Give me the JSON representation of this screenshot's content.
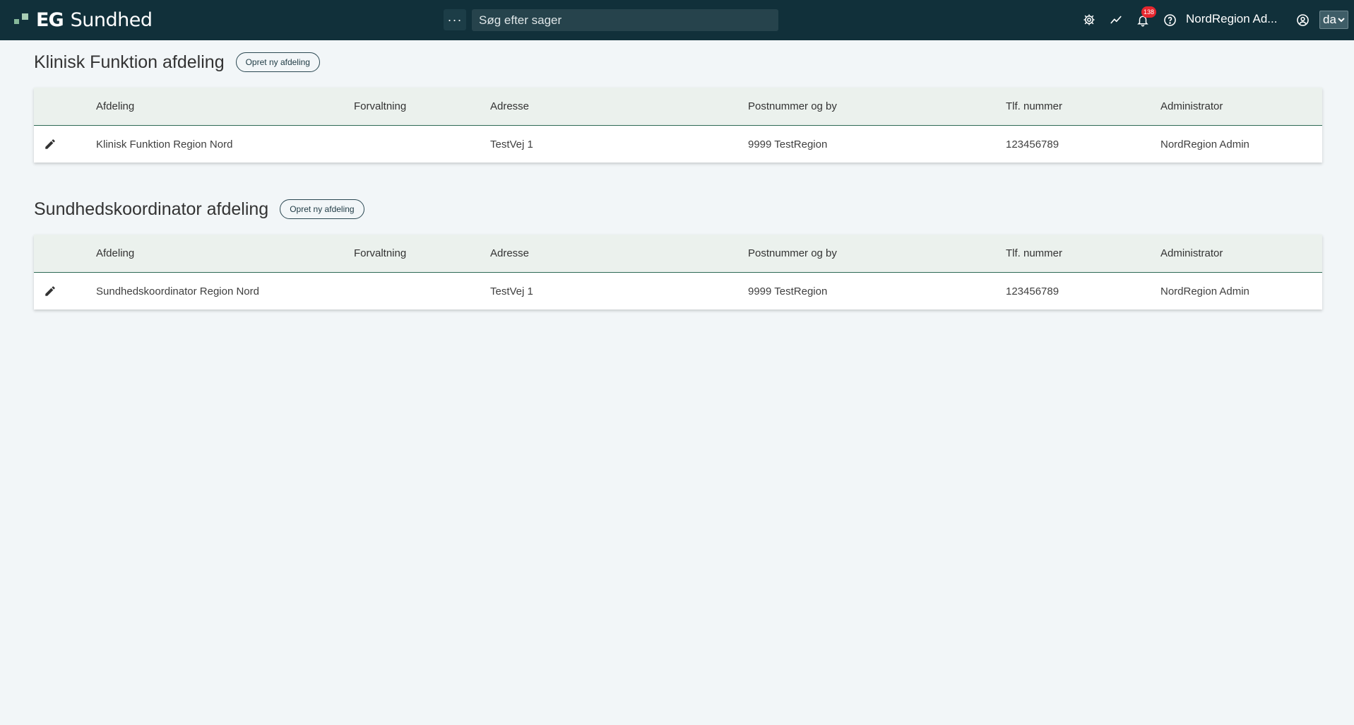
{
  "header": {
    "brand_short": "EG",
    "brand_name": "Sundhed",
    "menu_label": "···",
    "search_placeholder": "Søg efter sager",
    "notification_count": "138",
    "user_name": "NordRegion Ad...",
    "language": "da"
  },
  "sections": [
    {
      "title": "Klinisk Funktion afdeling",
      "new_button": "Opret ny afdeling",
      "columns": [
        "Afdeling",
        "Forvaltning",
        "Adresse",
        "Postnummer og by",
        "Tlf. nummer",
        "Administrator"
      ],
      "rows": [
        {
          "afdeling": "Klinisk Funktion Region Nord",
          "forvaltning": "",
          "adresse": "TestVej 1",
          "postnummer": "9999 TestRegion",
          "tlf": "123456789",
          "administrator": "NordRegion Admin"
        }
      ]
    },
    {
      "title": "Sundhedskoordinator afdeling",
      "new_button": "Opret ny afdeling",
      "columns": [
        "Afdeling",
        "Forvaltning",
        "Adresse",
        "Postnummer og by",
        "Tlf. nummer",
        "Administrator"
      ],
      "rows": [
        {
          "afdeling": "Sundhedskoordinator Region Nord",
          "forvaltning": "",
          "adresse": "TestVej 1",
          "postnummer": "9999 TestRegion",
          "tlf": "123456789",
          "administrator": "NordRegion Admin"
        }
      ]
    }
  ],
  "icons": {
    "logo": "eg-logo-icon",
    "settings": "gear-icon",
    "statistics": "trend-line-icon",
    "notifications": "bell-icon",
    "help": "help-icon",
    "profile": "user-circle-icon",
    "edit": "pencil-icon",
    "dropdown": "chevron-down-icon"
  },
  "colors": {
    "topbar": "#11303a",
    "background": "#f2f6f8",
    "table_header": "#ebf1ed",
    "header_border": "#2e6a55",
    "badge": "#e5262e"
  }
}
